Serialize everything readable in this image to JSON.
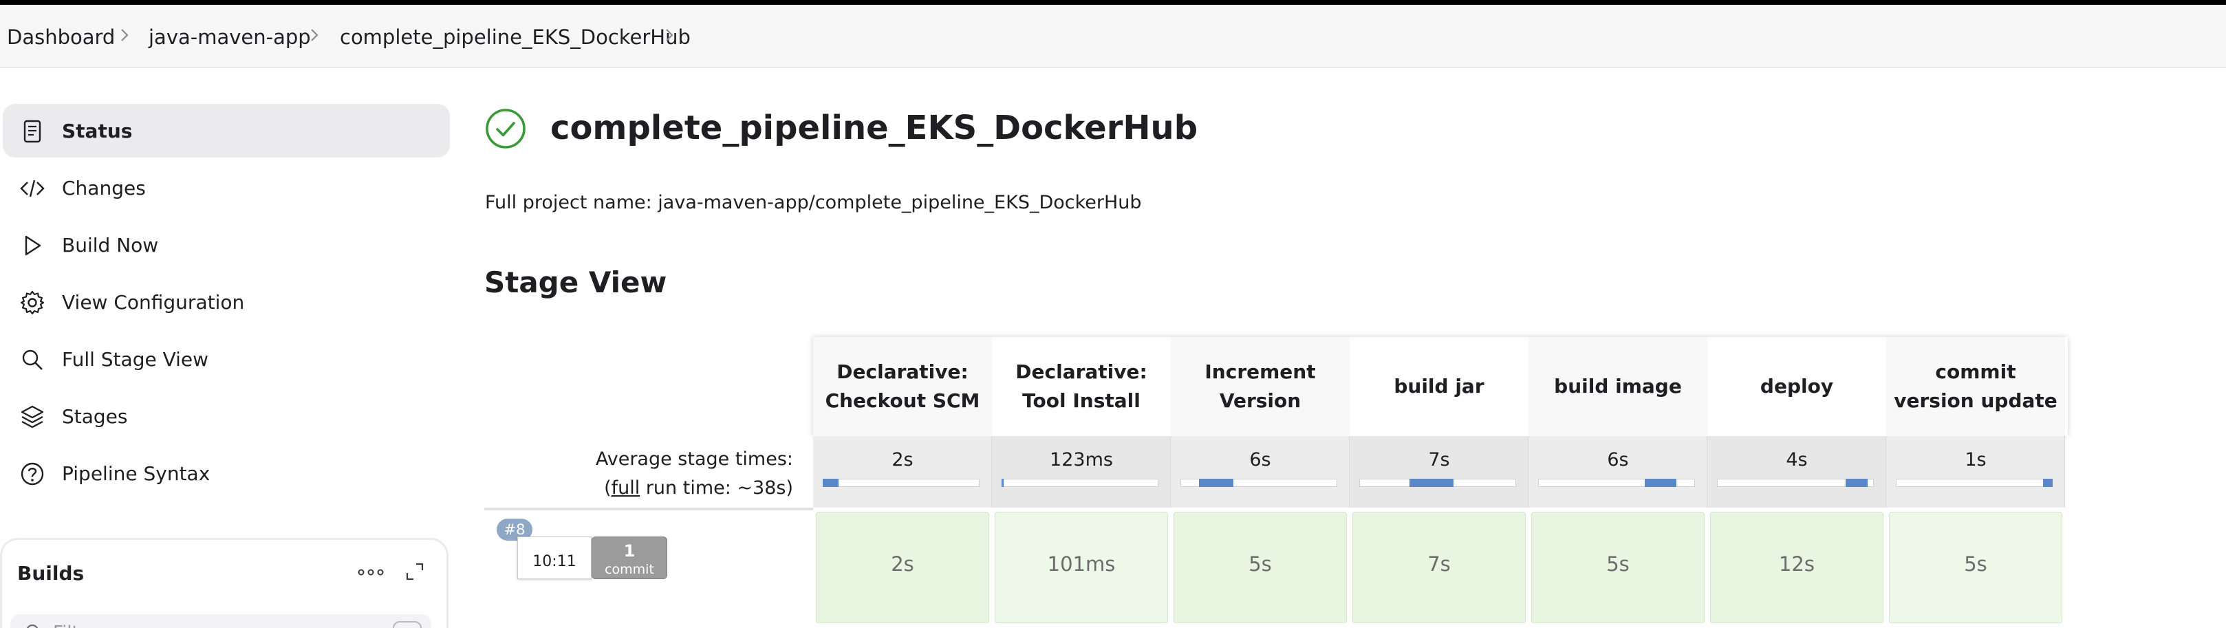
{
  "breadcrumb": {
    "items": [
      "Dashboard",
      "java-maven-app",
      "complete_pipeline_EKS_DockerHub"
    ]
  },
  "sidebar": {
    "items": [
      {
        "label": "Status",
        "icon": "document-icon",
        "active": true
      },
      {
        "label": "Changes",
        "icon": "code-icon",
        "active": false
      },
      {
        "label": "Build Now",
        "icon": "play-icon",
        "active": false
      },
      {
        "label": "View Configuration",
        "icon": "gear-icon",
        "active": false
      },
      {
        "label": "Full Stage View",
        "icon": "search-icon",
        "active": false
      },
      {
        "label": "Stages",
        "icon": "layers-icon",
        "active": false
      },
      {
        "label": "Pipeline Syntax",
        "icon": "help-icon",
        "active": false
      }
    ]
  },
  "builds": {
    "title": "Builds",
    "filter_placeholder": "Filter"
  },
  "main": {
    "title": "complete_pipeline_EKS_DockerHub",
    "status": "success",
    "full_project_name": "Full project name: java-maven-app/complete_pipeline_EKS_DockerHub",
    "stage_view_title": "Stage View"
  },
  "stage_view": {
    "avg_label": "Average stage times:",
    "full_run_prefix": "(",
    "full_run_link": "full",
    "full_run_suffix": " run time: ~38s)",
    "stages": [
      {
        "line1": "Declarative:",
        "line2": "Checkout SCM",
        "avg": "2s",
        "bar_start": 0.0,
        "bar_fraction": 0.1
      },
      {
        "line1": "Declarative:",
        "line2": "Tool Install",
        "avg": "123ms",
        "bar_start": 0.0,
        "bar_fraction": 0.01
      },
      {
        "line1": "Increment",
        "line2": "Version",
        "avg": "6s",
        "bar_start": 0.12,
        "bar_fraction": 0.22
      },
      {
        "line1": "build jar",
        "line2": "",
        "avg": "7s",
        "bar_start": 0.32,
        "bar_fraction": 0.28
      },
      {
        "line1": "build image",
        "line2": "",
        "avg": "6s",
        "bar_start": 0.68,
        "bar_fraction": 0.2
      },
      {
        "line1": "deploy",
        "line2": "",
        "avg": "4s",
        "bar_start": 0.82,
        "bar_fraction": 0.14
      },
      {
        "line1": "commit",
        "line2": "version update",
        "avg": "1s",
        "bar_start": 0.94,
        "bar_fraction": 0.06
      }
    ],
    "runs": [
      {
        "number": "#8",
        "time": "10:11",
        "commit_count": "1",
        "commit_word": "commit",
        "cells": [
          "2s",
          "101ms",
          "5s",
          "7s",
          "5s",
          "12s",
          "5s"
        ]
      }
    ]
  },
  "colors": {
    "success": "#3a9a3a",
    "success_cell": "#e8f5e1",
    "progress_bar": "#5b86c7",
    "run_badge": "#8ea7c7"
  }
}
